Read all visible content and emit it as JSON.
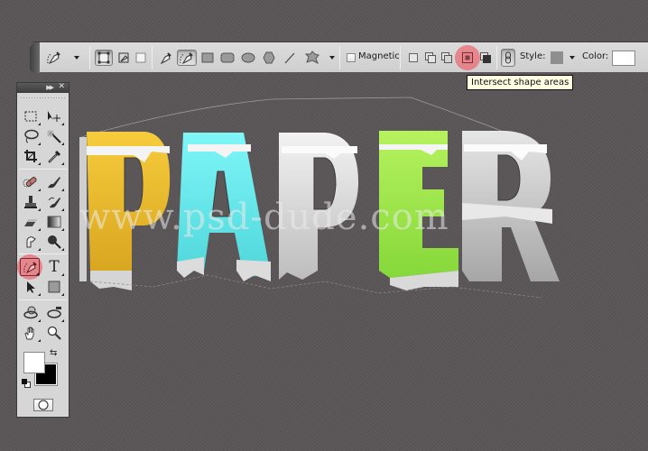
{
  "options_bar": {
    "preset_tool": "pen-tool-preset",
    "modes": [
      "shape-layers",
      "paths",
      "fill-pixels"
    ],
    "selected_mode": "shape-layers",
    "tools": [
      "pen",
      "freeform-pen",
      "rectangle",
      "rounded-rectangle",
      "ellipse",
      "polygon",
      "line",
      "custom-shape"
    ],
    "selected_tool": "freeform-pen",
    "magnetic_label": "Magnetic",
    "magnetic_checked": false,
    "path_ops": [
      "create-new-shape-layer",
      "add-to-shape-area",
      "subtract-from-shape-area",
      "intersect-shape-areas",
      "exclude-overlapping-shape-areas"
    ],
    "highlighted_op": "intersect-shape-areas",
    "style_label": "Style:",
    "color_label": "Color:",
    "style_swatch": "#8e8e8e",
    "color_swatch": "#ffffff",
    "highlight_color": "#f04650"
  },
  "tooltip": {
    "text": "Intersect shape areas"
  },
  "tools_panel": {
    "header_icons": [
      "collapse-icon",
      "close-icon"
    ],
    "tools": [
      {
        "name": "rectangular-marquee"
      },
      {
        "name": "move"
      },
      {
        "name": "lasso"
      },
      {
        "name": "magic-wand"
      },
      {
        "name": "crop"
      },
      {
        "name": "eyedropper"
      },
      {
        "name": "spot-healing-brush"
      },
      {
        "name": "brush"
      },
      {
        "name": "clone-stamp"
      },
      {
        "name": "history-brush"
      },
      {
        "name": "eraser"
      },
      {
        "name": "gradient"
      },
      {
        "name": "smudge"
      },
      {
        "name": "burn"
      },
      {
        "name": "freeform-pen",
        "active": true
      },
      {
        "name": "type",
        "glyph": "T"
      },
      {
        "name": "path-selection"
      },
      {
        "name": "rectangle"
      },
      {
        "name": "3d-rotate"
      },
      {
        "name": "3d-orbit"
      },
      {
        "name": "hand"
      },
      {
        "name": "zoom"
      }
    ],
    "foreground_color": "#ffffff",
    "background_color": "#000000"
  },
  "canvas": {
    "background": "#5b5657",
    "artwork_text": "PAPER",
    "letters": [
      {
        "char": "P",
        "color": "#e9b92c"
      },
      {
        "char": "A",
        "color": "#6ee8ea"
      },
      {
        "char": "P",
        "color": "#d9d9d9"
      },
      {
        "char": "E",
        "color": "#a8ee52"
      },
      {
        "char": "R",
        "color": "#dedede"
      }
    ],
    "watermark": "www.psd-dude.com"
  }
}
